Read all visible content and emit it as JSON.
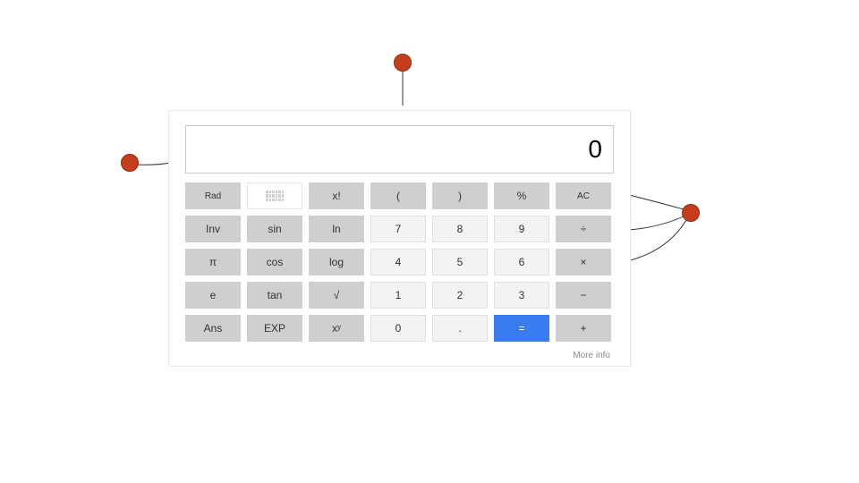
{
  "display": {
    "value": "0"
  },
  "buttons": {
    "rad": "Rad",
    "factorial": "x!",
    "lparen": "(",
    "rparen": ")",
    "percent": "%",
    "ac": "AC",
    "inv": "Inv",
    "sin": "sin",
    "ln": "ln",
    "n7": "7",
    "n8": "8",
    "n9": "9",
    "divide": "÷",
    "pi": "π",
    "cos": "cos",
    "log": "log",
    "n4": "4",
    "n5": "5",
    "n6": "6",
    "multiply": "×",
    "econst": "e",
    "tan": "tan",
    "sqrt": "√",
    "n1": "1",
    "n2": "2",
    "n3": "3",
    "minus": "−",
    "ans": "Ans",
    "exp": "EXP",
    "pow": "xʸ",
    "n0": "0",
    "dot": ".",
    "equals": "=",
    "plus": "+"
  },
  "footer": {
    "more_info": "More info"
  }
}
